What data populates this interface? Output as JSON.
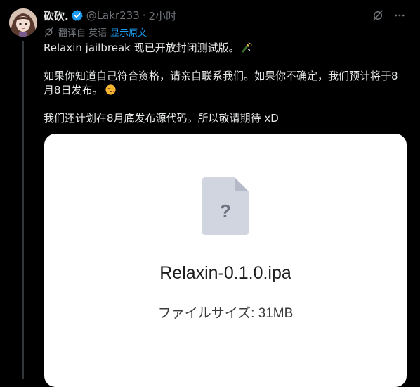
{
  "author": {
    "display_name": "砍砍.",
    "handle": "@Lakr233",
    "separator": "·",
    "time": "2小时",
    "verified": true
  },
  "icons": {
    "avatar": "avatar-image",
    "verified": "verified-badge-icon",
    "grok": "grok-icon",
    "more": "more-icon",
    "translate": "translate-icon",
    "file": "file-question-icon",
    "emoji_bottle": "champagne-emoji",
    "emoji_kiss": "kissing-face-emoji"
  },
  "translation": {
    "translated_from": "翻译自 英语",
    "show_original": "显示原文"
  },
  "tweet": {
    "para1": "Relaxin jailbreak 现已开放封闭测试版。",
    "para2": "如果你知道自己符合资格，请亲自联系我们。如果你不确定，我们预计将于8月8日发布。",
    "para3": "我们还计划在8月底发布源代码。所以敬请期待 xD"
  },
  "attachment": {
    "file_name": "Relaxin-0.1.0.ipa",
    "file_size": "ファイルサイズ: 31MB",
    "question_mark": "?"
  },
  "colors": {
    "background": "#000000",
    "text": "#e7e9ea",
    "muted": "#71767b",
    "link": "#1d9bf0",
    "card_bg": "#ffffff",
    "file_icon": "#d1d5e0"
  }
}
